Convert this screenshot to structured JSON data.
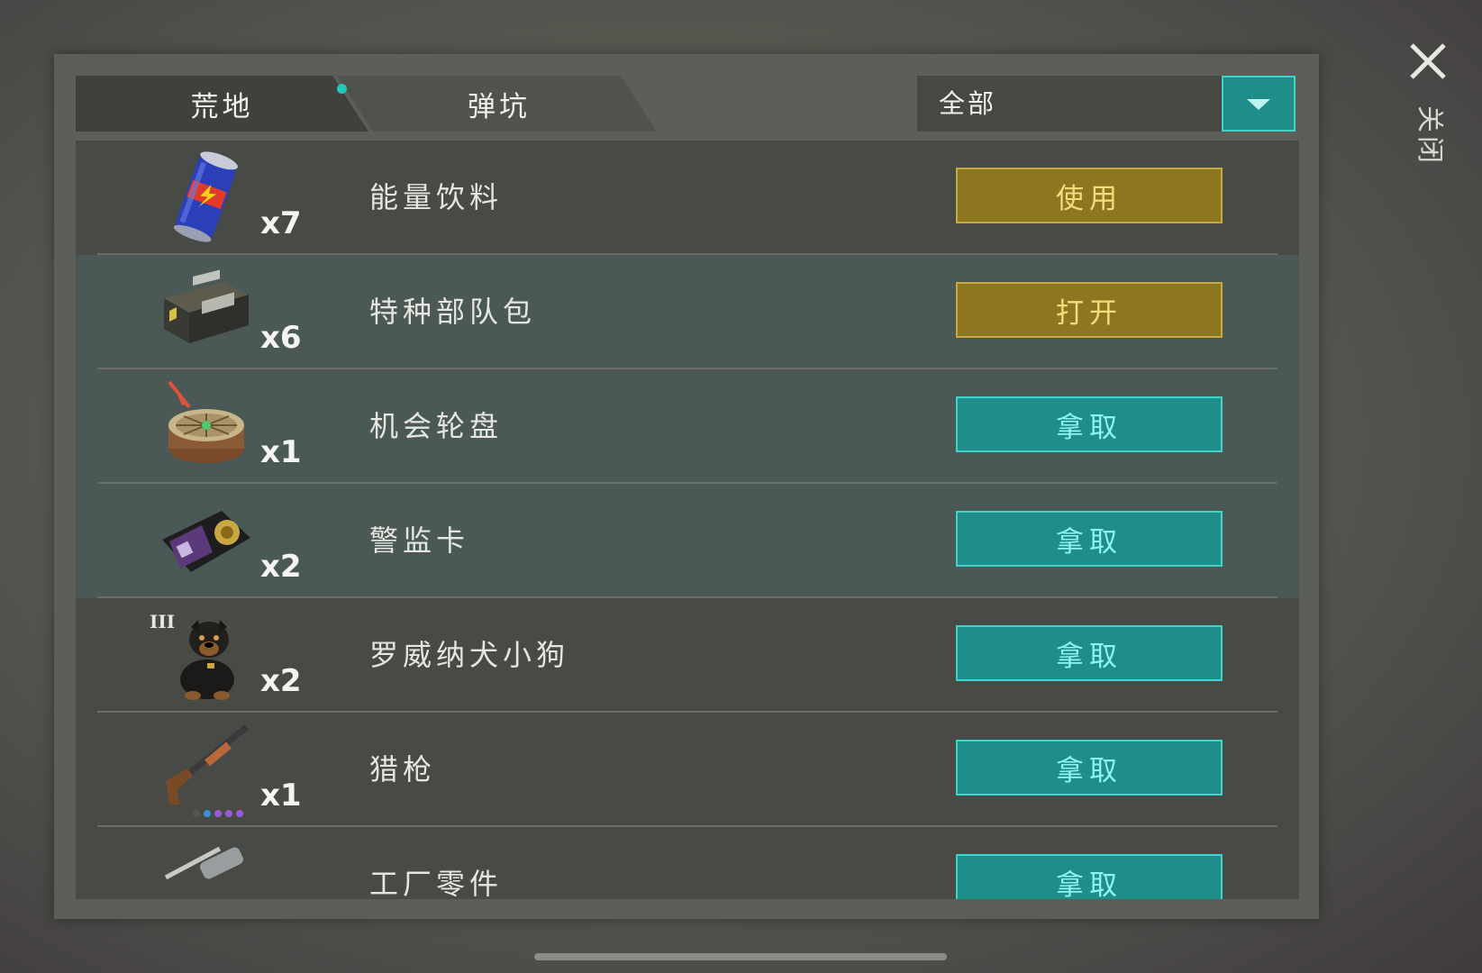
{
  "tabs": [
    {
      "label": "荒地",
      "active": true,
      "has_dot": true
    },
    {
      "label": "弹坑",
      "active": false
    }
  ],
  "filter": {
    "selected": "全部"
  },
  "close_label": [
    "关",
    "闭"
  ],
  "items": [
    {
      "name": "能量饮料",
      "qty": "x7",
      "action": "使用",
      "action_style": "gold",
      "icon": "energy-drink-icon"
    },
    {
      "name": "特种部队包",
      "qty": "x6",
      "action": "打开",
      "action_style": "gold",
      "icon": "special-forces-crate-icon"
    },
    {
      "name": "机会轮盘",
      "qty": "x1",
      "action": "拿取",
      "action_style": "teal",
      "icon": "chance-wheel-icon"
    },
    {
      "name": "警监卡",
      "qty": "x2",
      "action": "拿取",
      "action_style": "teal",
      "icon": "warden-card-icon"
    },
    {
      "name": "罗威纳犬小狗",
      "qty": "x2",
      "action": "拿取",
      "action_style": "teal",
      "icon": "rottweiler-puppy-icon",
      "tier": "III"
    },
    {
      "name": "猎枪",
      "qty": "x1",
      "action": "拿取",
      "action_style": "teal",
      "icon": "shotgun-icon"
    },
    {
      "name": "工厂零件",
      "qty": "",
      "action": "拿取",
      "action_style": "teal",
      "icon": "factory-parts-icon"
    }
  ],
  "colors": {
    "teal": "#1f8d89",
    "gold": "#8c7620",
    "dot": "#23c6c0"
  }
}
